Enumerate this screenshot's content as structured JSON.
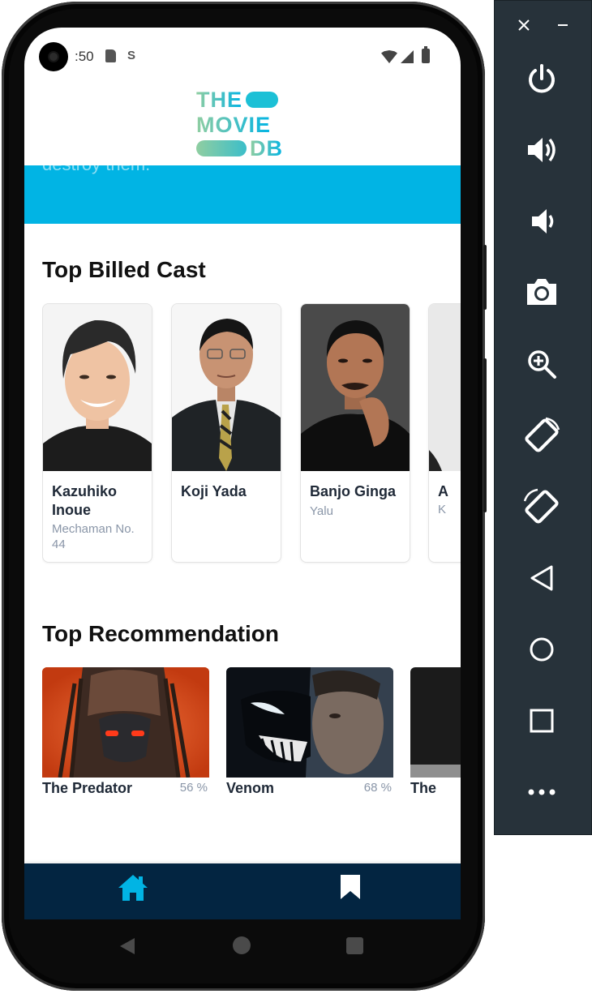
{
  "status_bar": {
    "time": ":50"
  },
  "logo": {
    "line1": "THE",
    "line2": "MOVIE",
    "line3": "DB"
  },
  "banner": {
    "text": "destroy them."
  },
  "cast_section": {
    "title": "Top Billed Cast",
    "cast": [
      {
        "name": "Kazuhiko Inoue",
        "role": "Mechaman No. 44"
      },
      {
        "name": "Koji Yada",
        "role": ""
      },
      {
        "name": "Banjo Ginga",
        "role": "Yalu"
      },
      {
        "name": "A",
        "role": "K"
      }
    ]
  },
  "recommendation_section": {
    "title": "Top Recommendation",
    "items": [
      {
        "title": "The Predator",
        "score": "56 %"
      },
      {
        "title": "Venom",
        "score": "68 %"
      },
      {
        "title": "The",
        "score": ""
      }
    ]
  },
  "bottom_nav": {
    "items": [
      {
        "icon": "home-icon",
        "active": true
      },
      {
        "icon": "bookmark-icon",
        "active": false
      }
    ]
  },
  "colors": {
    "accent": "#01b4e4",
    "nav_background": "#032541",
    "logo_gradient_start": "#90cea1",
    "logo_gradient_end": "#01b4e4",
    "emulator_panel": "#27323a"
  },
  "emulator_controls": {
    "window": [
      "close-icon",
      "minimize-icon"
    ],
    "buttons": [
      "power-icon",
      "volume-up-icon",
      "volume-down-icon",
      "camera-icon",
      "zoom-icon",
      "rotate-left-icon",
      "rotate-right-icon",
      "back-icon",
      "home-icon",
      "overview-icon",
      "more-icon"
    ]
  }
}
